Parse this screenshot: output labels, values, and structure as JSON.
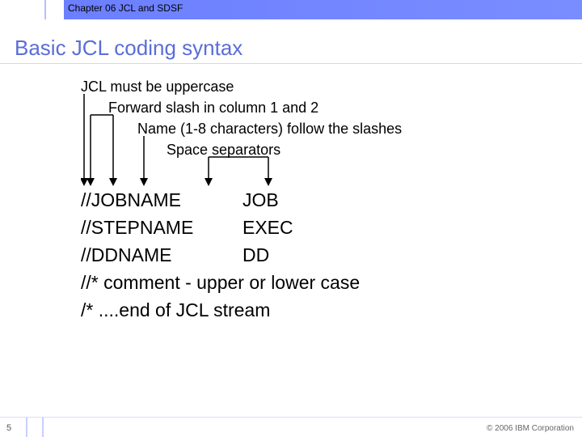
{
  "header": {
    "chapter": "Chapter 06 JCL and SDSF"
  },
  "title": "Basic JCL coding syntax",
  "rules": {
    "r1": "JCL must be uppercase",
    "r2": "Forward slash in column 1 and 2",
    "r3": "Name (1-8 characters) follow the slashes",
    "r4": "Space separators"
  },
  "code": {
    "l1c1": "//JOBNAME",
    "l1c2": "JOB",
    "l2c1": "//STEPNAME",
    "l2c2": "EXEC",
    "l3c1": "//DDNAME",
    "l3c2": "DD",
    "l4": "//* comment - upper or lower case",
    "l5": "/*  ....end of JCL stream"
  },
  "footer": {
    "page": "5",
    "copyright": "© 2006 IBM Corporation"
  }
}
